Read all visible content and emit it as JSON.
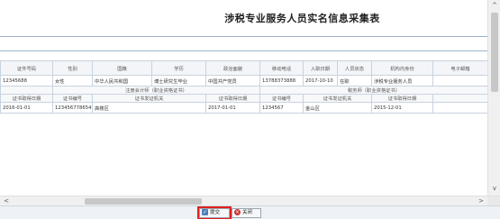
{
  "page": {
    "title": "涉税专业服务人员实名信息采集表"
  },
  "table": {
    "headers": [
      "证件号码",
      "性别",
      "国籍",
      "学历",
      "政治面貌",
      "移动电话",
      "入职日期",
      "人员状态",
      "机构内身份",
      "电子邮箱"
    ],
    "row1": [
      "12345688",
      "女性",
      "中华人民共和国",
      "博士研究生毕业",
      "中国共产党员",
      "13788373888",
      "2017-10-10",
      "在职",
      "涉税专业服务人员",
      ""
    ],
    "group_row": [
      "",
      "注册会计师（职业资格证书）",
      "税务师（职业资格证书）"
    ],
    "sub_headers": [
      "证书取得日期",
      "证书编号",
      "证书发证机关",
      "证书取得日期",
      "证书编号",
      "证书发证机关",
      "证书取得日期",
      ""
    ],
    "row2": [
      "2016-01-01",
      "123456778654",
      "高楼区",
      "2017-01-01",
      "1234567",
      "金山区",
      "2015-12-01",
      ""
    ]
  },
  "buttons": {
    "submit": "提交",
    "close": "关闭"
  },
  "scroll": {
    "left_arrow": "<",
    "right_arrow": ">",
    "up_arrow": "^",
    "down_arrow": "v"
  },
  "colors": {
    "submit_highlight": "#e02020",
    "border": "#c8d3df"
  }
}
